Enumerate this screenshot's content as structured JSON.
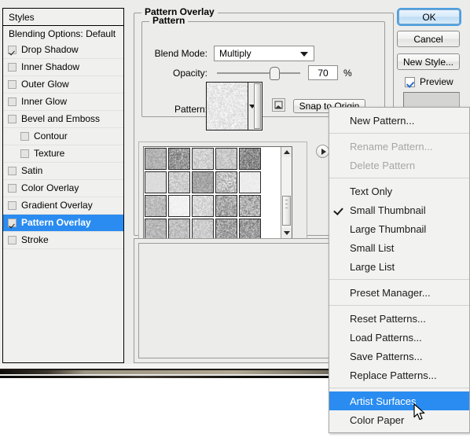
{
  "styles_panel": {
    "header": "Styles",
    "blending_options": "Blending Options: Default",
    "items": [
      {
        "label": "Drop Shadow",
        "checked": true,
        "indent": false,
        "selected": false
      },
      {
        "label": "Inner Shadow",
        "checked": false,
        "indent": false,
        "selected": false
      },
      {
        "label": "Outer Glow",
        "checked": false,
        "indent": false,
        "selected": false
      },
      {
        "label": "Inner Glow",
        "checked": false,
        "indent": false,
        "selected": false
      },
      {
        "label": "Bevel and Emboss",
        "checked": false,
        "indent": false,
        "selected": false
      },
      {
        "label": "Contour",
        "checked": false,
        "indent": true,
        "selected": false
      },
      {
        "label": "Texture",
        "checked": false,
        "indent": true,
        "selected": false
      },
      {
        "label": "Satin",
        "checked": false,
        "indent": false,
        "selected": false
      },
      {
        "label": "Color Overlay",
        "checked": false,
        "indent": false,
        "selected": false
      },
      {
        "label": "Gradient Overlay",
        "checked": false,
        "indent": false,
        "selected": false
      },
      {
        "label": "Pattern Overlay",
        "checked": true,
        "indent": false,
        "selected": true
      },
      {
        "label": "Stroke",
        "checked": false,
        "indent": false,
        "selected": false
      }
    ]
  },
  "pattern_overlay": {
    "group_title": "Pattern Overlay",
    "pattern_group_title": "Pattern",
    "blend_mode_label": "Blend Mode:",
    "blend_mode_value": "Multiply",
    "opacity_label": "Opacity:",
    "opacity_value": "70",
    "opacity_unit": "%",
    "opacity_percent": 70,
    "pattern_label": "Pattern:",
    "snap_to_origin_label": "Snap to Origin"
  },
  "buttons": {
    "ok": "OK",
    "cancel": "Cancel",
    "new_style": "New Style...",
    "preview": "Preview"
  },
  "context_menu": {
    "items": [
      {
        "label": "New Pattern...",
        "state": "normal",
        "checked": false
      },
      {
        "type": "separator"
      },
      {
        "label": "Rename Pattern...",
        "state": "disabled",
        "checked": false
      },
      {
        "label": "Delete Pattern",
        "state": "disabled",
        "checked": false
      },
      {
        "type": "separator"
      },
      {
        "label": "Text Only",
        "state": "normal",
        "checked": false
      },
      {
        "label": "Small Thumbnail",
        "state": "normal",
        "checked": true
      },
      {
        "label": "Large Thumbnail",
        "state": "normal",
        "checked": false
      },
      {
        "label": "Small List",
        "state": "normal",
        "checked": false
      },
      {
        "label": "Large List",
        "state": "normal",
        "checked": false
      },
      {
        "type": "separator"
      },
      {
        "label": "Preset Manager...",
        "state": "normal",
        "checked": false
      },
      {
        "type": "separator"
      },
      {
        "label": "Reset Patterns...",
        "state": "normal",
        "checked": false
      },
      {
        "label": "Load Patterns...",
        "state": "normal",
        "checked": false
      },
      {
        "label": "Save Patterns...",
        "state": "normal",
        "checked": false
      },
      {
        "label": "Replace Patterns...",
        "state": "normal",
        "checked": false
      },
      {
        "type": "separator"
      },
      {
        "label": "Artist Surfaces",
        "state": "selected",
        "checked": false
      },
      {
        "label": "Color Paper",
        "state": "normal",
        "checked": false
      }
    ]
  },
  "pattern_picker": {
    "swatch_count": 20,
    "columns": 6,
    "swatches": [
      {
        "tone": "#b4b4b4",
        "grain": "fine-med"
      },
      {
        "tone": "#9a9a9a",
        "grain": "coarse-dark"
      },
      {
        "tone": "#d2d2d2",
        "grain": "fine-light"
      },
      {
        "tone": "#c8c8c8",
        "grain": "speckle"
      },
      {
        "tone": "#8e8e8e",
        "grain": "very-coarse"
      },
      {
        "tone": "#dcdcdc",
        "grain": "faint"
      },
      {
        "tone": "#cfcfcf",
        "grain": "cross-weave"
      },
      {
        "tone": "#a6a6a6",
        "grain": "canvas"
      },
      {
        "tone": "#c4c4c4",
        "grain": "scratch"
      },
      {
        "tone": "#ededed",
        "grain": "near-white"
      },
      {
        "tone": "#bdbdbd",
        "grain": "marble"
      },
      {
        "tone": "#f2f2f2",
        "grain": "blank"
      },
      {
        "tone": "#d8d8d8",
        "grain": "noise-light"
      },
      {
        "tone": "#a8a8a8",
        "grain": "noise-med"
      },
      {
        "tone": "#b0b0b0",
        "grain": "fiber"
      },
      {
        "tone": "#b8b8b8",
        "grain": "burlap"
      },
      {
        "tone": "#c0c0c0",
        "grain": "smooth"
      },
      {
        "tone": "#cdcdcd",
        "grain": "grain-light"
      },
      {
        "tone": "#a2a2a2",
        "grain": "dark-noise"
      },
      {
        "tone": "#9e9e9e",
        "grain": "dark-fiber"
      }
    ]
  },
  "colors": {
    "selection_blue": "#2a8cf0",
    "dialog_bg": "#ececeb",
    "menu_bg": "#f2f2f1",
    "ok_focus_ring": "#4b9fe3"
  }
}
